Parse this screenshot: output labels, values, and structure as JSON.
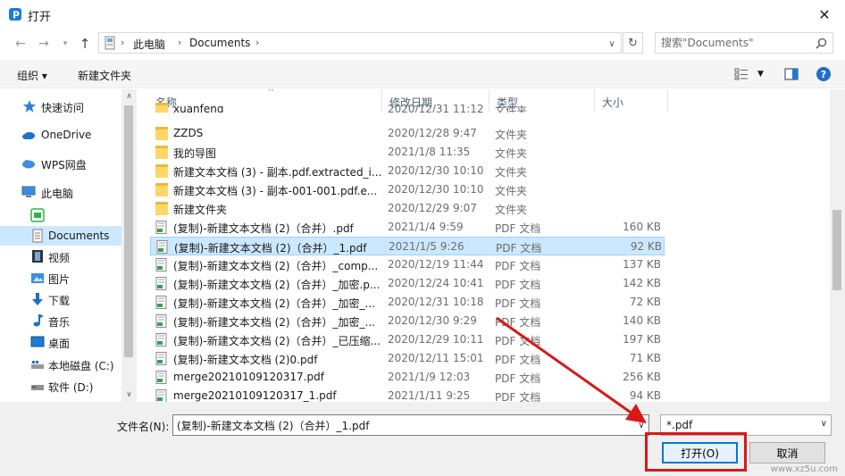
{
  "window": {
    "title": "打开"
  },
  "address": {
    "crumbs": [
      "此电脑",
      "Documents"
    ]
  },
  "search": {
    "placeholder": "搜索\"Documents\""
  },
  "toolbar": {
    "organize_label": "组织 ▾",
    "new_folder_label": "新建文件夹"
  },
  "navpane": {
    "items": [
      {
        "label": "快速访问",
        "icon": "star-icon"
      },
      {
        "label": "OneDrive",
        "icon": "cloud-icon"
      },
      {
        "label": "WPS网盘",
        "icon": "wps-cloud-icon"
      },
      {
        "label": "此电脑",
        "icon": "computer-icon"
      },
      {
        "label": "",
        "icon": "green-app-icon"
      },
      {
        "label": "Documents",
        "icon": "documents-icon"
      },
      {
        "label": "视频",
        "icon": "video-icon"
      },
      {
        "label": "图片",
        "icon": "pictures-icon"
      },
      {
        "label": "下载",
        "icon": "download-icon"
      },
      {
        "label": "音乐",
        "icon": "music-icon"
      },
      {
        "label": "桌面",
        "icon": "desktop-icon"
      },
      {
        "label": "本地磁盘 (C:)",
        "icon": "drive-icon"
      },
      {
        "label": "软件 (D:)",
        "icon": "drive-icon"
      }
    ]
  },
  "columns": {
    "name": "名称",
    "date": "修改日期",
    "type": "类型",
    "size": "大小"
  },
  "files": [
    {
      "name": "xuanfeng",
      "date": "2020/12/31 11:12",
      "type": "文件夹",
      "size": "",
      "kind": "folder"
    },
    {
      "name": "ZZDS",
      "date": "2020/12/28 9:47",
      "type": "文件夹",
      "size": "",
      "kind": "folder"
    },
    {
      "name": "我的导图",
      "date": "2021/1/8 11:35",
      "type": "文件夹",
      "size": "",
      "kind": "folder"
    },
    {
      "name": "新建文本文档 (3) - 副本.pdf.extracted_i...",
      "date": "2020/12/30 10:10",
      "type": "文件夹",
      "size": "",
      "kind": "folder"
    },
    {
      "name": "新建文本文档 (3) - 副本-001-001.pdf.e...",
      "date": "2020/12/30 10:10",
      "type": "文件夹",
      "size": "",
      "kind": "folder"
    },
    {
      "name": "新建文件夹",
      "date": "2020/12/29 9:07",
      "type": "文件夹",
      "size": "",
      "kind": "folder"
    },
    {
      "name": "(复制)-新建文本文档 (2)（合并）.pdf",
      "date": "2021/1/4 9:59",
      "type": "PDF 文档",
      "size": "160 KB",
      "kind": "pdf"
    },
    {
      "name": "(复制)-新建文本文档 (2)（合并）_1.pdf",
      "date": "2021/1/5 9:26",
      "type": "PDF 文档",
      "size": "92 KB",
      "kind": "pdf",
      "selected": true
    },
    {
      "name": "(复制)-新建文本文档 (2)（合并）_comp...",
      "date": "2020/12/19 11:44",
      "type": "PDF 文档",
      "size": "137 KB",
      "kind": "pdf"
    },
    {
      "name": "(复制)-新建文本文档 (2)（合并）_加密.p...",
      "date": "2020/12/24 10:41",
      "type": "PDF 文档",
      "size": "142 KB",
      "kind": "pdf"
    },
    {
      "name": "(复制)-新建文本文档 (2)（合并）_加密_...",
      "date": "2020/12/31 10:18",
      "type": "PDF 文档",
      "size": "72 KB",
      "kind": "pdf"
    },
    {
      "name": "(复制)-新建文本文档 (2)（合并）_加密_...",
      "date": "2020/12/30 9:29",
      "type": "PDF 文档",
      "size": "140 KB",
      "kind": "pdf"
    },
    {
      "name": "(复制)-新建文本文档 (2)（合并）_已压缩...",
      "date": "2020/12/29 10:11",
      "type": "PDF 文档",
      "size": "197 KB",
      "kind": "pdf"
    },
    {
      "name": "(复制)-新建文本文档 (2)0.pdf",
      "date": "2020/12/11 15:01",
      "type": "PDF 文档",
      "size": "71 KB",
      "kind": "pdf"
    },
    {
      "name": "merge20210109120317.pdf",
      "date": "2021/1/9 12:03",
      "type": "PDF 文档",
      "size": "256 KB",
      "kind": "pdf"
    },
    {
      "name": "merge20210109120317_1.pdf",
      "date": "2021/1/11 9:25",
      "type": "PDF 文档",
      "size": "94 KB",
      "kind": "pdf"
    }
  ],
  "bottom": {
    "filename_label": "文件名(N):",
    "filename_value": "(复制)-新建文本文档 (2)（合并）_1.pdf",
    "filter_value": "*.pdf",
    "open_label": "打开(O)",
    "cancel_label": "取消"
  },
  "colors": {
    "selection": "#cce8ff",
    "accent": "#0078d7",
    "annotation": "#d7191c"
  },
  "watermark": "www.xz5u.com"
}
